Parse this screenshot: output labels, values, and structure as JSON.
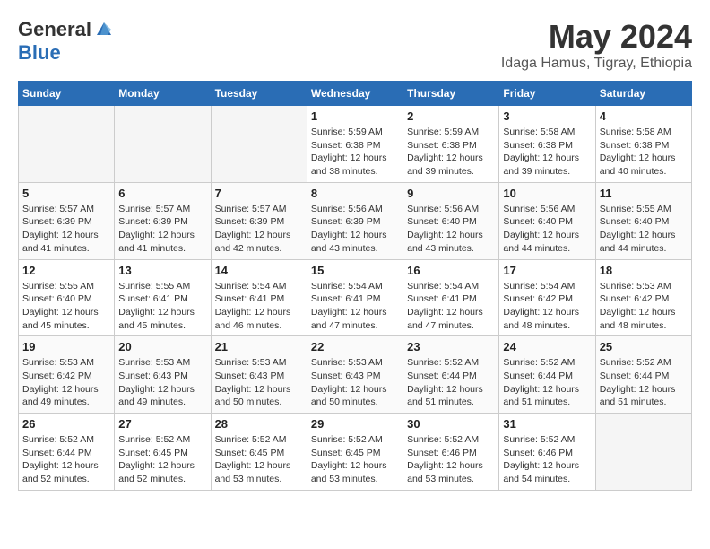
{
  "logo": {
    "general": "General",
    "blue": "Blue"
  },
  "title": {
    "month_year": "May 2024",
    "location": "Idaga Hamus, Tigray, Ethiopia"
  },
  "weekdays": [
    "Sunday",
    "Monday",
    "Tuesday",
    "Wednesday",
    "Thursday",
    "Friday",
    "Saturday"
  ],
  "weeks": [
    [
      {
        "day": "",
        "info": ""
      },
      {
        "day": "",
        "info": ""
      },
      {
        "day": "",
        "info": ""
      },
      {
        "day": "1",
        "info": "Sunrise: 5:59 AM\nSunset: 6:38 PM\nDaylight: 12 hours\nand 38 minutes."
      },
      {
        "day": "2",
        "info": "Sunrise: 5:59 AM\nSunset: 6:38 PM\nDaylight: 12 hours\nand 39 minutes."
      },
      {
        "day": "3",
        "info": "Sunrise: 5:58 AM\nSunset: 6:38 PM\nDaylight: 12 hours\nand 39 minutes."
      },
      {
        "day": "4",
        "info": "Sunrise: 5:58 AM\nSunset: 6:38 PM\nDaylight: 12 hours\nand 40 minutes."
      }
    ],
    [
      {
        "day": "5",
        "info": "Sunrise: 5:57 AM\nSunset: 6:39 PM\nDaylight: 12 hours\nand 41 minutes."
      },
      {
        "day": "6",
        "info": "Sunrise: 5:57 AM\nSunset: 6:39 PM\nDaylight: 12 hours\nand 41 minutes."
      },
      {
        "day": "7",
        "info": "Sunrise: 5:57 AM\nSunset: 6:39 PM\nDaylight: 12 hours\nand 42 minutes."
      },
      {
        "day": "8",
        "info": "Sunrise: 5:56 AM\nSunset: 6:39 PM\nDaylight: 12 hours\nand 43 minutes."
      },
      {
        "day": "9",
        "info": "Sunrise: 5:56 AM\nSunset: 6:40 PM\nDaylight: 12 hours\nand 43 minutes."
      },
      {
        "day": "10",
        "info": "Sunrise: 5:56 AM\nSunset: 6:40 PM\nDaylight: 12 hours\nand 44 minutes."
      },
      {
        "day": "11",
        "info": "Sunrise: 5:55 AM\nSunset: 6:40 PM\nDaylight: 12 hours\nand 44 minutes."
      }
    ],
    [
      {
        "day": "12",
        "info": "Sunrise: 5:55 AM\nSunset: 6:40 PM\nDaylight: 12 hours\nand 45 minutes."
      },
      {
        "day": "13",
        "info": "Sunrise: 5:55 AM\nSunset: 6:41 PM\nDaylight: 12 hours\nand 45 minutes."
      },
      {
        "day": "14",
        "info": "Sunrise: 5:54 AM\nSunset: 6:41 PM\nDaylight: 12 hours\nand 46 minutes."
      },
      {
        "day": "15",
        "info": "Sunrise: 5:54 AM\nSunset: 6:41 PM\nDaylight: 12 hours\nand 47 minutes."
      },
      {
        "day": "16",
        "info": "Sunrise: 5:54 AM\nSunset: 6:41 PM\nDaylight: 12 hours\nand 47 minutes."
      },
      {
        "day": "17",
        "info": "Sunrise: 5:54 AM\nSunset: 6:42 PM\nDaylight: 12 hours\nand 48 minutes."
      },
      {
        "day": "18",
        "info": "Sunrise: 5:53 AM\nSunset: 6:42 PM\nDaylight: 12 hours\nand 48 minutes."
      }
    ],
    [
      {
        "day": "19",
        "info": "Sunrise: 5:53 AM\nSunset: 6:42 PM\nDaylight: 12 hours\nand 49 minutes."
      },
      {
        "day": "20",
        "info": "Sunrise: 5:53 AM\nSunset: 6:43 PM\nDaylight: 12 hours\nand 49 minutes."
      },
      {
        "day": "21",
        "info": "Sunrise: 5:53 AM\nSunset: 6:43 PM\nDaylight: 12 hours\nand 50 minutes."
      },
      {
        "day": "22",
        "info": "Sunrise: 5:53 AM\nSunset: 6:43 PM\nDaylight: 12 hours\nand 50 minutes."
      },
      {
        "day": "23",
        "info": "Sunrise: 5:52 AM\nSunset: 6:44 PM\nDaylight: 12 hours\nand 51 minutes."
      },
      {
        "day": "24",
        "info": "Sunrise: 5:52 AM\nSunset: 6:44 PM\nDaylight: 12 hours\nand 51 minutes."
      },
      {
        "day": "25",
        "info": "Sunrise: 5:52 AM\nSunset: 6:44 PM\nDaylight: 12 hours\nand 51 minutes."
      }
    ],
    [
      {
        "day": "26",
        "info": "Sunrise: 5:52 AM\nSunset: 6:44 PM\nDaylight: 12 hours\nand 52 minutes."
      },
      {
        "day": "27",
        "info": "Sunrise: 5:52 AM\nSunset: 6:45 PM\nDaylight: 12 hours\nand 52 minutes."
      },
      {
        "day": "28",
        "info": "Sunrise: 5:52 AM\nSunset: 6:45 PM\nDaylight: 12 hours\nand 53 minutes."
      },
      {
        "day": "29",
        "info": "Sunrise: 5:52 AM\nSunset: 6:45 PM\nDaylight: 12 hours\nand 53 minutes."
      },
      {
        "day": "30",
        "info": "Sunrise: 5:52 AM\nSunset: 6:46 PM\nDaylight: 12 hours\nand 53 minutes."
      },
      {
        "day": "31",
        "info": "Sunrise: 5:52 AM\nSunset: 6:46 PM\nDaylight: 12 hours\nand 54 minutes."
      },
      {
        "day": "",
        "info": ""
      }
    ]
  ]
}
